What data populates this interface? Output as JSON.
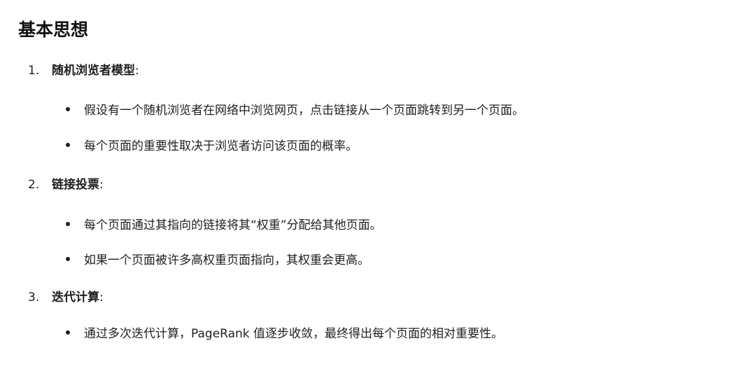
{
  "title": "基本思想",
  "colon": ":",
  "items": [
    {
      "number": "1.",
      "term": "随机浏览者模型",
      "bullets": [
        "假设有一个随机浏览者在网络中浏览网页，点击链接从一个页面跳转到另一个页面。",
        "每个页面的重要性取决于浏览者访问该页面的概率。"
      ]
    },
    {
      "number": "2.",
      "term": "链接投票",
      "bullets": [
        "每个页面通过其指向的链接将其“权重”分配给其他页面。",
        "如果一个页面被许多高权重页面指向，其权重会更高。"
      ]
    },
    {
      "number": "3.",
      "term": "迭代计算",
      "bullets": [
        "通过多次迭代计算，PageRank 值逐步收敛，最终得出每个页面的相对重要性。"
      ]
    }
  ]
}
